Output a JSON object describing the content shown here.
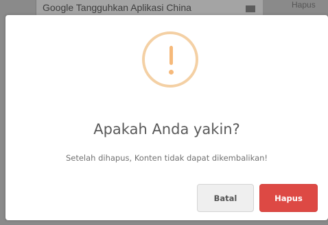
{
  "background": {
    "row_text": "Google Tangguhkan Aplikasi China",
    "right_text": "Hapus"
  },
  "dialog": {
    "icon": "exclamation-icon",
    "title": "Apakah Anda yakin?",
    "message": "Setelah dihapus, Konten tidak dapat dikembalikan!",
    "cancel_label": "Batal",
    "confirm_label": "Hapus"
  },
  "colors": {
    "warning": "#f6b97a",
    "danger": "#dd4944",
    "cancel_bg": "#efefef"
  }
}
